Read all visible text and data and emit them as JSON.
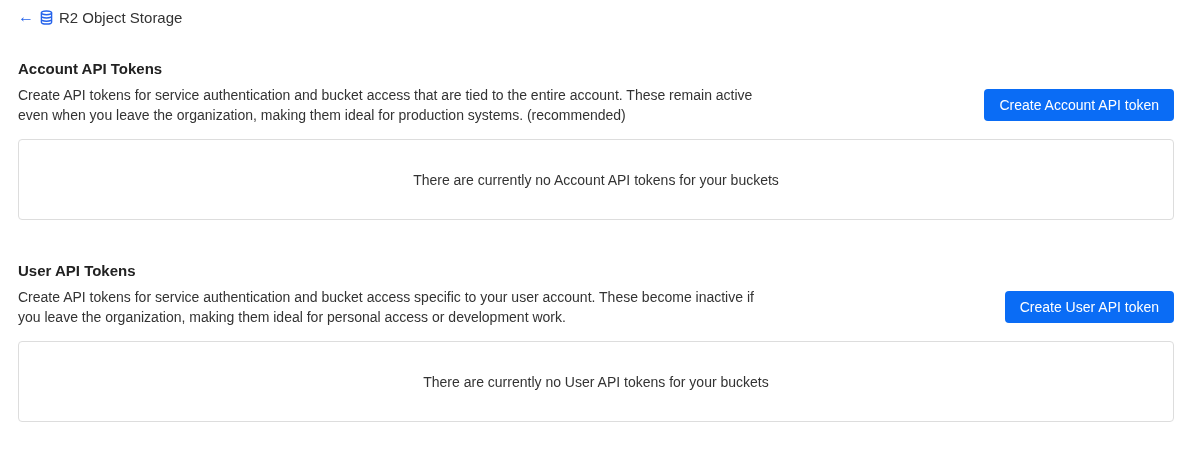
{
  "breadcrumb": {
    "back": "←",
    "label": "R2 Object Storage"
  },
  "sections": [
    {
      "title": "Account API Tokens",
      "description": "Create API tokens for service authentication and bucket access that are tied to the entire account. These remain active even when you leave the organization, making them ideal for production systems. (recommended)",
      "button": "Create Account API token",
      "empty_message": "There are currently no Account API tokens for your buckets"
    },
    {
      "title": "User API Tokens",
      "description": "Create API tokens for service authentication and bucket access specific to your user account. These become inactive if you leave the organization, making them ideal for personal access or development work.",
      "button": "Create User API token",
      "empty_message": "There are currently no User API tokens for your buckets"
    }
  ]
}
